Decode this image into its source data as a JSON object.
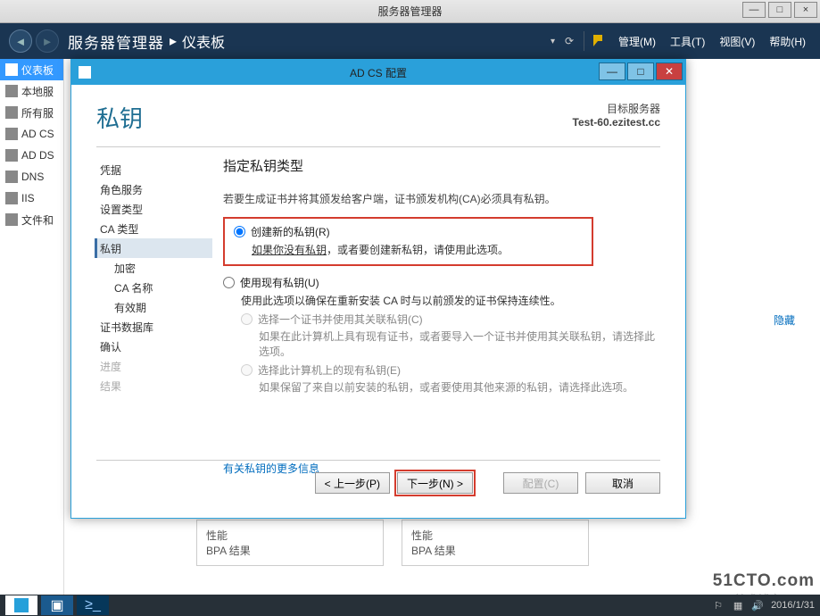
{
  "outer": {
    "title": "服务器管理器",
    "min": "—",
    "max": "□",
    "close": "×"
  },
  "header": {
    "app_title": "服务器管理器",
    "breadcrumb_sep": "▸",
    "breadcrumb_page": "仪表板",
    "menus": {
      "manage": "管理(M)",
      "tools": "工具(T)",
      "view": "视图(V)",
      "help": "帮助(H)"
    }
  },
  "sidebar": {
    "items": [
      {
        "label": "仪表板"
      },
      {
        "label": "本地服"
      },
      {
        "label": "所有服"
      },
      {
        "label": "AD CS"
      },
      {
        "label": "AD DS"
      },
      {
        "label": "DNS"
      },
      {
        "label": "IIS"
      },
      {
        "label": "文件和"
      }
    ]
  },
  "main": {
    "hide_link": "隐藏",
    "bg_panels": [
      {
        "line1": "性能",
        "line2": "BPA 结果"
      },
      {
        "line1": "性能",
        "line2": "BPA 结果"
      }
    ]
  },
  "wizard": {
    "titlebar": "AD CS 配置",
    "header_left": "私钥",
    "target_label": "目标服务器",
    "target_value": "Test-60.ezitest.cc",
    "nav": [
      {
        "label": "凭据"
      },
      {
        "label": "角色服务"
      },
      {
        "label": "设置类型"
      },
      {
        "label": "CA 类型"
      },
      {
        "label": "私钥"
      },
      {
        "label": "加密"
      },
      {
        "label": "CA 名称"
      },
      {
        "label": "有效期"
      },
      {
        "label": "证书数据库"
      },
      {
        "label": "确认"
      },
      {
        "label": "进度"
      },
      {
        "label": "结果"
      }
    ],
    "content": {
      "section_title": "指定私钥类型",
      "info": "若要生成证书并将其颁发给客户端，证书颁发机构(CA)必须具有私钥。",
      "opt1_label": "创建新的私钥(R)",
      "opt1_desc_pre": "如果你没有私钥",
      "opt1_desc_post": "，或者要创建新私钥，请使用此选项。",
      "opt2_label": "使用现有私钥(U)",
      "opt2_desc": "使用此选项以确保在重新安装 CA 时与以前颁发的证书保持连续性。",
      "sub1_label": "选择一个证书并使用其关联私钥(C)",
      "sub1_desc": "如果在此计算机上具有现有证书，或者要导入一个证书并使用其关联私钥，请选择此选项。",
      "sub2_label": "选择此计算机上的现有私钥(E)",
      "sub2_desc": "如果保留了来自以前安装的私钥，或者要使用其他来源的私钥，请选择此选项。",
      "more_link": "有关私钥的更多信息"
    },
    "buttons": {
      "prev": "< 上一步(P)",
      "next": "下一步(N) >",
      "configure": "配置(C)",
      "cancel": "取消"
    }
  },
  "taskbar": {
    "date": "2016/1/31",
    "watermark_top": "51CTO.com",
    "watermark_bottom": "技术博客 · Blog"
  }
}
